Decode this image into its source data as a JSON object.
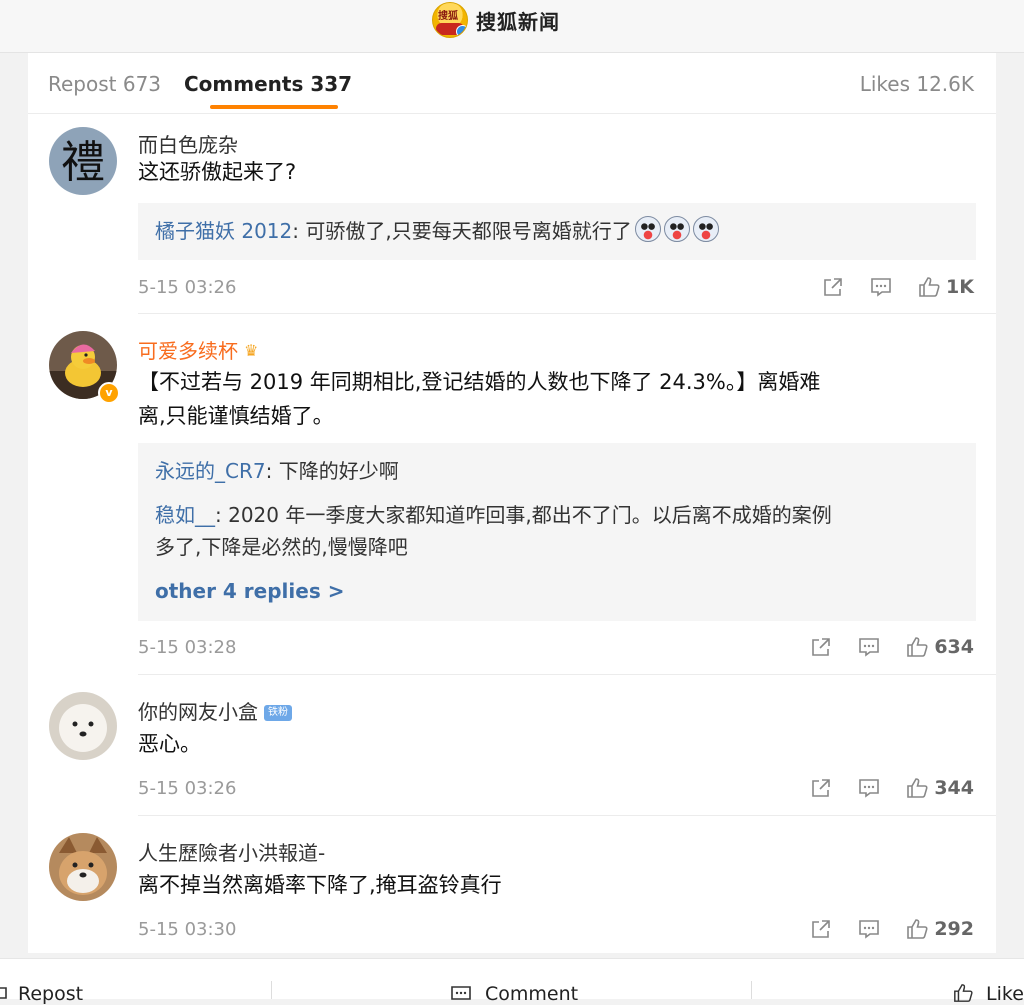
{
  "header": {
    "brand_logo_text": "搜狐",
    "brand_name": "搜狐新闻"
  },
  "tabs": {
    "repost": "Repost 673",
    "comments": "Comments 337",
    "likes": "Likes 12.6K"
  },
  "colors": {
    "accent": "#ff8200",
    "reply_name": "#3f6fa8",
    "vip_name": "#f86c1e"
  },
  "comments": [
    {
      "user": "而白色庞杂",
      "avatar_char": "禮",
      "text": "这还骄傲起来了?",
      "replies": [
        {
          "name": "橘子猫妖 2012",
          "text": ": 可骄傲了,只要每天都限号离婚就行了"
        }
      ],
      "time": "5-15 03:26",
      "likes": "1K"
    },
    {
      "user": "可爱多续杯",
      "crown_icon": "crown-emoji",
      "verified_mark": "v",
      "text_line1": "【不过若与 2019 年同期相比,登记结婚的人数也下降了 24.3%。】离婚难",
      "text_line2": "离,只能谨慎结婚了。",
      "replies": [
        {
          "name": "永远的_CR7",
          "text": ": 下降的好少啊"
        },
        {
          "name": "稳如__",
          "text_line1": ": 2020 年一季度大家都知道咋回事,都出不了门。以后离不成婚的案例",
          "text_line2": "多了,下降是必然的,慢慢降吧"
        }
      ],
      "more_replies": "other 4 replies >",
      "time": "5-15 03:28",
      "likes": "634"
    },
    {
      "user": "你的网友小盒",
      "fan_badge": "铁粉",
      "text": "恶心。",
      "time": "5-15 03:26",
      "likes": "344"
    },
    {
      "user": "人生歷險者小洪報道-",
      "text": "离不掉当然离婚率下降了,掩耳盗铃真行",
      "time": "5-15 03:30",
      "likes": "292"
    }
  ],
  "bottom_bar": {
    "repost": "Repost",
    "comment": "Comment",
    "like": "Like"
  }
}
